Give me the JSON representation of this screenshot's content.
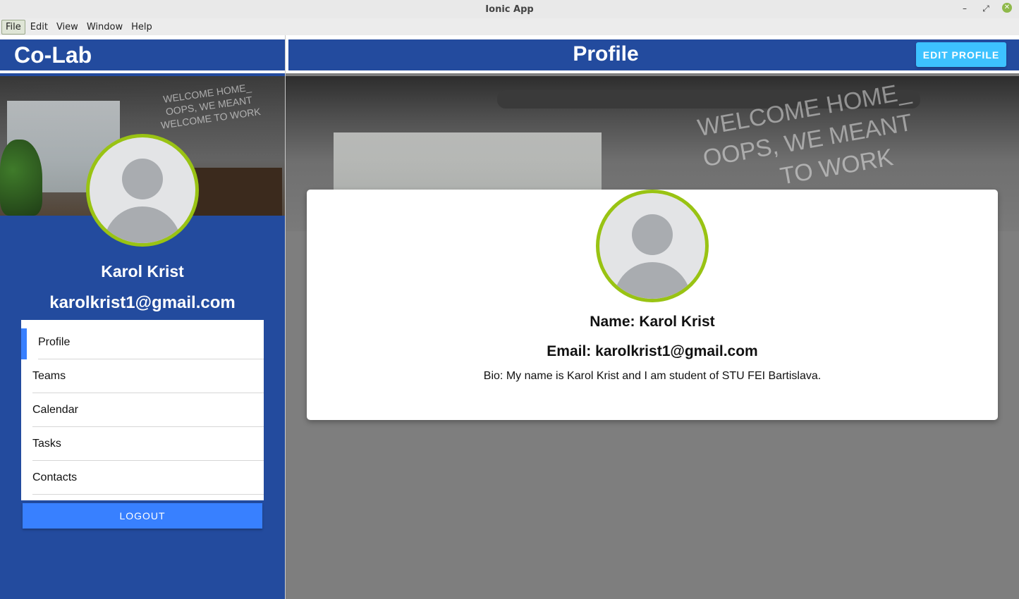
{
  "window": {
    "title": "Ionic App",
    "controls": {
      "minimize": "–",
      "maximize": "⤢",
      "close": "✕"
    }
  },
  "menubar": {
    "items": [
      {
        "label": "File",
        "active": true
      },
      {
        "label": "Edit"
      },
      {
        "label": "View"
      },
      {
        "label": "Window"
      },
      {
        "label": "Help"
      }
    ]
  },
  "sidebar": {
    "app_title": "Co-Lab",
    "cover_neon": "WELCOME HOME_\nOOPS, WE MEANT\nWELCOME TO WORK",
    "user": {
      "name": "Karol Krist",
      "email": "karolkrist1@gmail.com"
    },
    "nav": [
      {
        "label": "Profile",
        "active": true
      },
      {
        "label": "Teams"
      },
      {
        "label": "Calendar"
      },
      {
        "label": "Tasks"
      },
      {
        "label": "Contacts"
      }
    ],
    "logout_label": "LOGOUT"
  },
  "main": {
    "page_title": "Profile",
    "edit_label": "EDIT PROFILE",
    "cover_neon": "WELCOME HOME_\nOOPS, WE MEANT\n           TO WORK",
    "card": {
      "name_line": "Name: Karol Krist",
      "email_line": "Email: karolkrist1@gmail.com",
      "bio_line": "Bio: My name is Karol Krist and I am student of STU FEI Bartislava."
    }
  },
  "colors": {
    "primary": "#234b9e",
    "accent": "#3880ff",
    "edit_button": "#3dc2ff",
    "avatar_ring": "#99c313"
  }
}
